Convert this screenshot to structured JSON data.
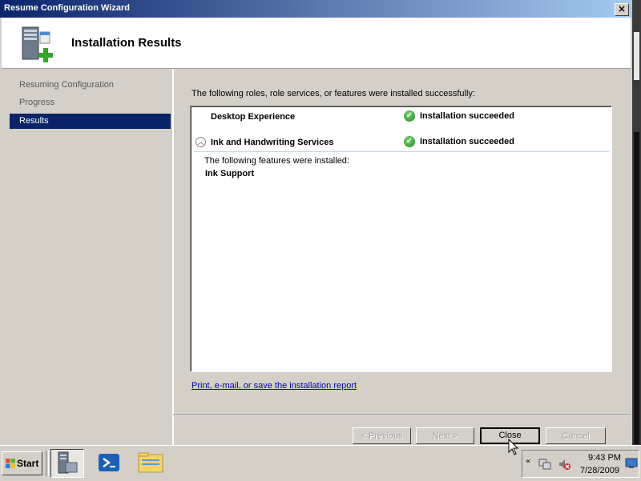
{
  "window": {
    "title": "Resume Configuration Wizard",
    "close_glyph": "×"
  },
  "header": {
    "title": "Installation Results",
    "icon": "server-add-icon"
  },
  "sidebar": {
    "items": [
      {
        "label": "Resuming Configuration",
        "active": false
      },
      {
        "label": "Progress",
        "active": false
      },
      {
        "label": "Results",
        "active": true
      }
    ]
  },
  "main": {
    "intro": "The following roles, role services, or features were installed successfully:",
    "results": [
      {
        "name": "Desktop Experience",
        "status": "Installation succeeded"
      },
      {
        "name": "Ink and Handwriting Services",
        "status": "Installation succeeded",
        "expanded": true
      }
    ],
    "detail_heading": "The following features were installed:",
    "detail_item": "Ink Support",
    "report_link": "Print, e-mail, or save the installation report"
  },
  "buttons": {
    "previous": "< Previous",
    "next": "Next >",
    "close": "Close",
    "cancel": "Cancel"
  },
  "taskbar": {
    "start_label": "Start",
    "clock_time": "9:43 PM",
    "clock_date": "7/28/2009",
    "tray_chevron": "«",
    "quick_launch": [
      "server-manager-icon",
      "powershell-icon",
      "explorer-icon"
    ]
  },
  "colors": {
    "titlebar_start": "#0a246a",
    "titlebar_end": "#a6caf0",
    "selection": "#0a246a",
    "link": "#0000cc",
    "success": "#1e8a1a"
  }
}
